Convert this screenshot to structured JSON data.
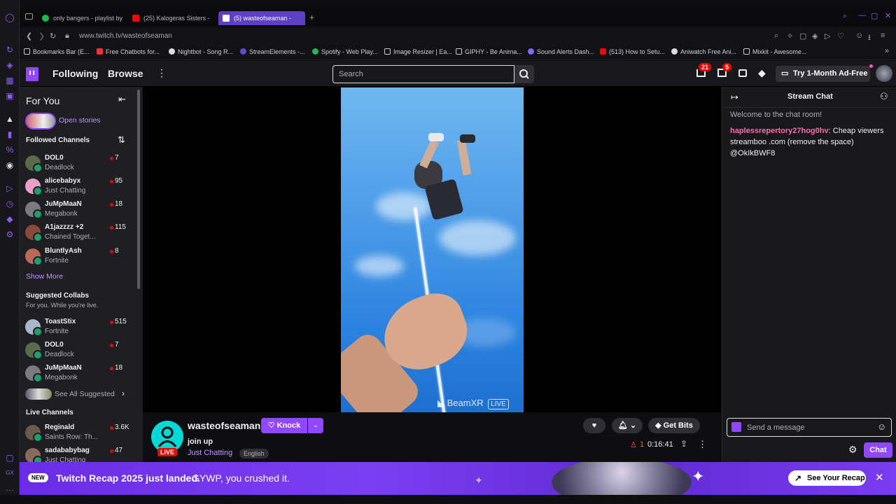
{
  "browser": {
    "tabs": [
      {
        "title": "only bangers - playlist by"
      },
      {
        "title": "(25) Kalogeras Sisters -"
      },
      {
        "title": "(5) wasteofseaman -"
      }
    ],
    "url": "www.twitch.tv/wasteofseaman",
    "bookmarks": [
      "Bookmarks Bar (E...",
      "Free Chatbots for...",
      "Nightbot - Song R...",
      "StreamElements -...",
      "Spotify - Web Play...",
      "Image Resizer | Ea...",
      "GIPHY - Be Anima...",
      "Sound Alerts Dash...",
      "(513) How to Setu...",
      "Aniwatch Free Ani...",
      "Mixkit - Awesome..."
    ]
  },
  "header": {
    "following": "Following",
    "browse": "Browse",
    "search_placeholder": "Search",
    "inbox_badge": "21",
    "notif_badge": "5",
    "try_label": "Try 1-Month Ad-Free"
  },
  "sidebar": {
    "for_you": "For You",
    "open_stories": "Open stories",
    "followed_title": "Followed Channels",
    "followed": [
      {
        "name": "DOL0",
        "game": "Deadlock",
        "viewers": "7"
      },
      {
        "name": "alicebabyx",
        "game": "Just Chatting",
        "viewers": "95"
      },
      {
        "name": "JuMpMaaN",
        "game": "Megabonk",
        "viewers": "18"
      },
      {
        "name": "A1jazzzz +2",
        "game": "Chained Toget...",
        "viewers": "115"
      },
      {
        "name": "BluntlyAsh",
        "game": "Fortnite",
        "viewers": "8"
      }
    ],
    "show_more": "Show More",
    "suggested_title": "Suggested Collabs",
    "suggested_sub": "For you. While you're live.",
    "suggested": [
      {
        "name": "ToastStix",
        "game": "Fortnite",
        "viewers": "515"
      },
      {
        "name": "DOL0",
        "game": "Deadlock",
        "viewers": "7"
      },
      {
        "name": "JuMpMaaN",
        "game": "Megabonk",
        "viewers": "18"
      }
    ],
    "see_all": "See All Suggested",
    "live_title": "Live Channels",
    "live": [
      {
        "name": "Reginald",
        "game": "Saints Row: Th...",
        "viewers": "3.6K"
      },
      {
        "name": "sadababybag",
        "game": "Just Chatting",
        "viewers": "47"
      }
    ]
  },
  "video": {
    "watermark": "BeamXR",
    "watermark_live": "LIVE"
  },
  "stream": {
    "streamer": "wasteofseaman",
    "live_label": "LIVE",
    "knock": "Knock",
    "title": "join up",
    "category": "Just Chatting",
    "tag": "English",
    "viewers": "1",
    "uptime": "0:16:41",
    "get_bits": "Get Bits"
  },
  "chat": {
    "title": "Stream Chat",
    "welcome": "Welcome to the chat room!",
    "messages": [
      {
        "user": "haplessrepertory27hog0hv",
        "text": "Cheap viewers streamboo .com (remove the space) @OkIkBWF8",
        "user_color": "#ff69b4"
      }
    ],
    "input_placeholder": "Send a message",
    "send_label": "Chat"
  },
  "banner": {
    "new_label": "NEW",
    "headline": "Twitch Recap 2025 just landed.",
    "sub": "GYWP, you crushed it.",
    "button": "See Your Recap"
  },
  "colors": {
    "accent": "#9147ff",
    "live_red": "#eb0400",
    "background": "#0e0e10"
  }
}
